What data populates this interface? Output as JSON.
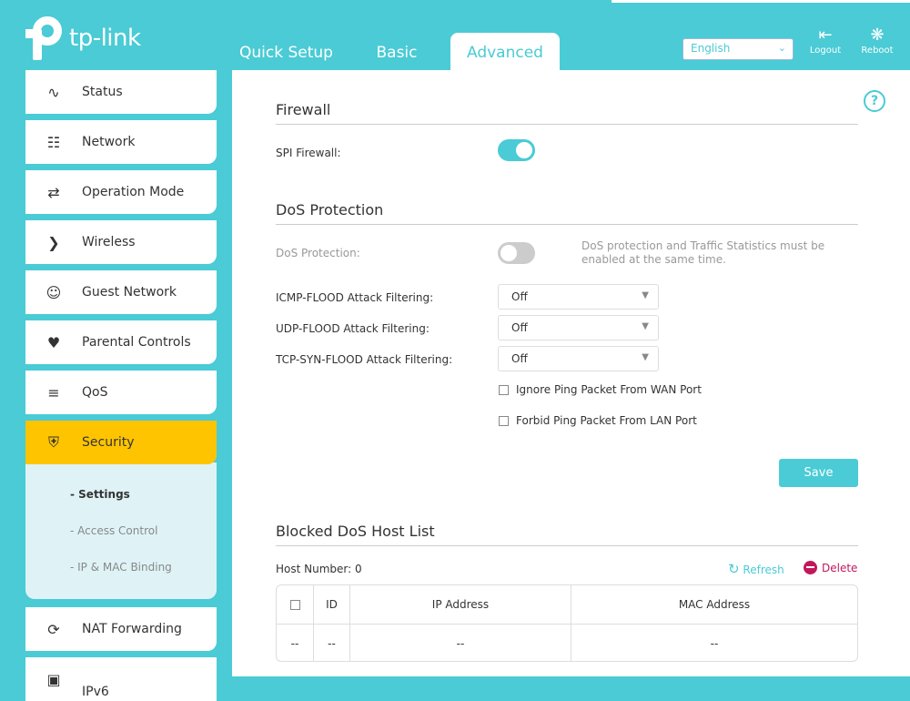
{
  "brand": "tp-link",
  "tabs": [
    "Quick Setup",
    "Basic",
    "Advanced"
  ],
  "language": "English",
  "top_buttons": {
    "logout": "Logout",
    "reboot": "Reboot"
  },
  "sidebar": [
    {
      "label": "Status",
      "icon": "pulse-icon"
    },
    {
      "label": "Network",
      "icon": "network-icon"
    },
    {
      "label": "Operation Mode",
      "icon": "mode-icon"
    },
    {
      "label": "Wireless",
      "icon": "wifi-icon"
    },
    {
      "label": "Guest Network",
      "icon": "guest-icon"
    },
    {
      "label": "Parental Controls",
      "icon": "family-icon"
    },
    {
      "label": "QoS",
      "icon": "qos-icon"
    },
    {
      "label": "Security",
      "icon": "shield-icon"
    },
    {
      "label": "NAT Forwarding",
      "icon": "nat-icon"
    },
    {
      "label": "IPv6",
      "icon": "ipv6-icon"
    }
  ],
  "submenu": [
    "- Settings",
    "- Access Control",
    "- IP & MAC Binding"
  ],
  "firewall": {
    "title": "Firewall",
    "spi_label": "SPI Firewall:",
    "spi_on": true
  },
  "dos": {
    "title": "DoS Protection",
    "label": "DoS Protection:",
    "on": false,
    "note": "DoS protection and Traffic Statistics must be enabled at the same time.",
    "filters": [
      {
        "label": "ICMP-FLOOD Attack Filtering:",
        "value": "Off"
      },
      {
        "label": "UDP-FLOOD Attack Filtering:",
        "value": "Off"
      },
      {
        "label": "TCP-SYN-FLOOD Attack Filtering:",
        "value": "Off"
      }
    ],
    "checks": [
      "Ignore Ping Packet From WAN Port",
      "Forbid Ping Packet From LAN Port"
    ],
    "save": "Save"
  },
  "blocked": {
    "title": "Blocked DoS Host List",
    "host_number": "Host Number: 0",
    "refresh": "Refresh",
    "delete": "Delete",
    "columns": [
      "ID",
      "IP Address",
      "MAC Address"
    ],
    "empty_row": [
      "--",
      "--",
      "--",
      "--"
    ]
  }
}
